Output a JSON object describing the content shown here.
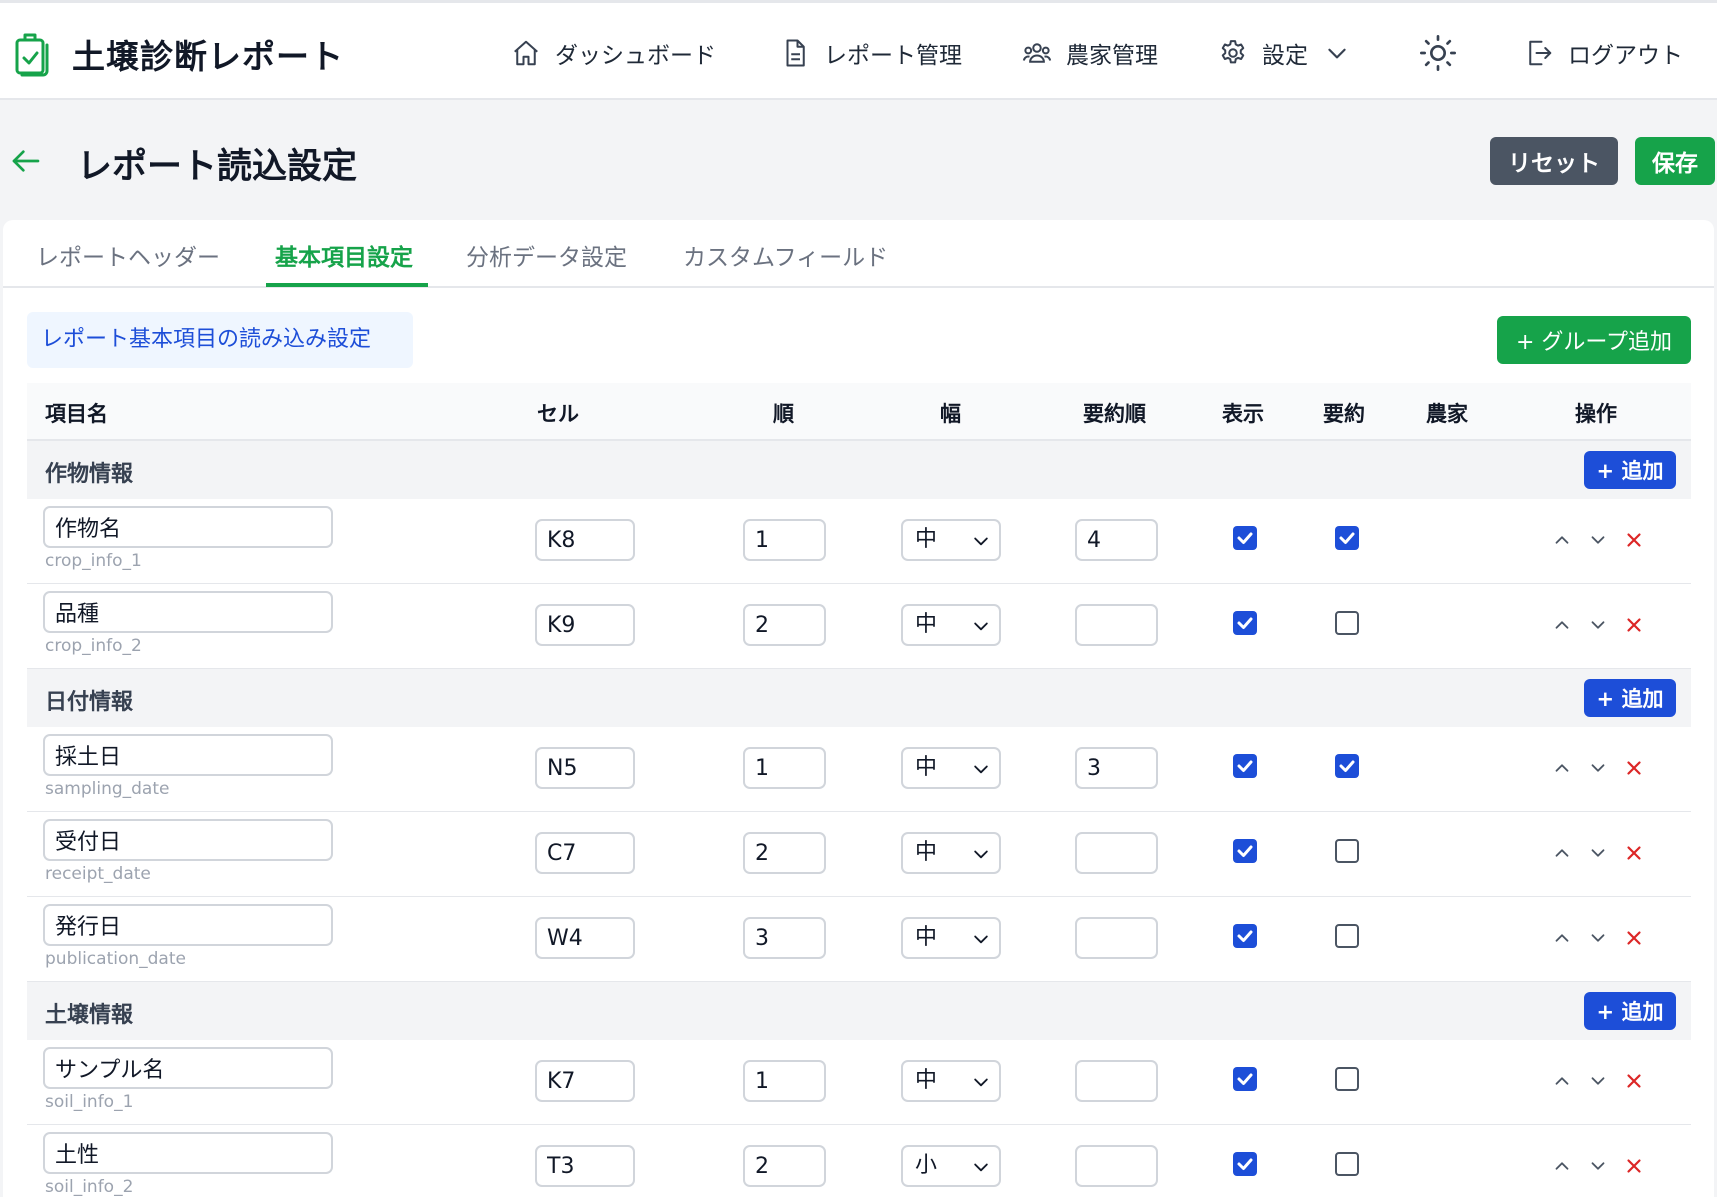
{
  "app": {
    "title": "土壌診断レポート"
  },
  "nav": {
    "dashboard": "ダッシュボード",
    "reports": "レポート管理",
    "farmers": "農家管理",
    "settings": "設定",
    "logout": "ログアウト"
  },
  "page": {
    "title": "レポート読込設定",
    "reset_label": "リセット",
    "save_label": "保存"
  },
  "tabs": [
    "レポートヘッダー",
    "基本項目設定",
    "分析データ設定",
    "カスタムフィールド"
  ],
  "active_tab": "基本項目設定",
  "info": "レポート基本項目の読み込み設定",
  "add_group_label": "+ グループ追加",
  "add_label": "+ 追加",
  "table": {
    "headers": [
      "項目名",
      "セル",
      "順",
      "幅",
      "要約順",
      "表示",
      "要約",
      "農家",
      "操作"
    ],
    "groups": [
      {
        "label": "作物情報",
        "items": [
          {
            "name": "作物名",
            "key": "crop_info_1",
            "cell": "K8",
            "order": "1",
            "width": "中",
            "summary_order": "4",
            "display": true,
            "summary": true
          },
          {
            "name": "品種",
            "key": "crop_info_2",
            "cell": "K9",
            "order": "2",
            "width": "中",
            "summary_order": "",
            "display": true,
            "summary": false
          }
        ]
      },
      {
        "label": "日付情報",
        "items": [
          {
            "name": "採土日",
            "key": "sampling_date",
            "cell": "N5",
            "order": "1",
            "width": "中",
            "summary_order": "3",
            "display": true,
            "summary": true
          },
          {
            "name": "受付日",
            "key": "receipt_date",
            "cell": "C7",
            "order": "2",
            "width": "中",
            "summary_order": "",
            "display": true,
            "summary": false
          },
          {
            "name": "発行日",
            "key": "publication_date",
            "cell": "W4",
            "order": "3",
            "width": "中",
            "summary_order": "",
            "display": true,
            "summary": false
          }
        ]
      },
      {
        "label": "土壌情報",
        "items": [
          {
            "name": "サンプル名",
            "key": "soil_info_1",
            "cell": "K7",
            "order": "1",
            "width": "中",
            "summary_order": "",
            "display": true,
            "summary": false
          },
          {
            "name": "土性",
            "key": "soil_info_2",
            "cell": "T3",
            "order": "2",
            "width": "小",
            "summary_order": "",
            "display": true,
            "summary": false
          }
        ]
      }
    ]
  },
  "colors": {
    "primary_green": "#16a34a",
    "primary_blue": "#1d4ed8",
    "reset_gray": "#4b5563",
    "delete_red": "#dc2626"
  },
  "icons": {
    "brand": "clipboard-check-icon",
    "dashboard": "home-icon",
    "reports": "document-icon",
    "farmers": "users-icon",
    "settings": "gear-icon",
    "theme": "sun-icon",
    "logout": "logout-icon",
    "back": "arrow-left-icon",
    "move_up": "chevron-up-icon",
    "move_down": "chevron-down-icon",
    "delete": "close-icon"
  }
}
